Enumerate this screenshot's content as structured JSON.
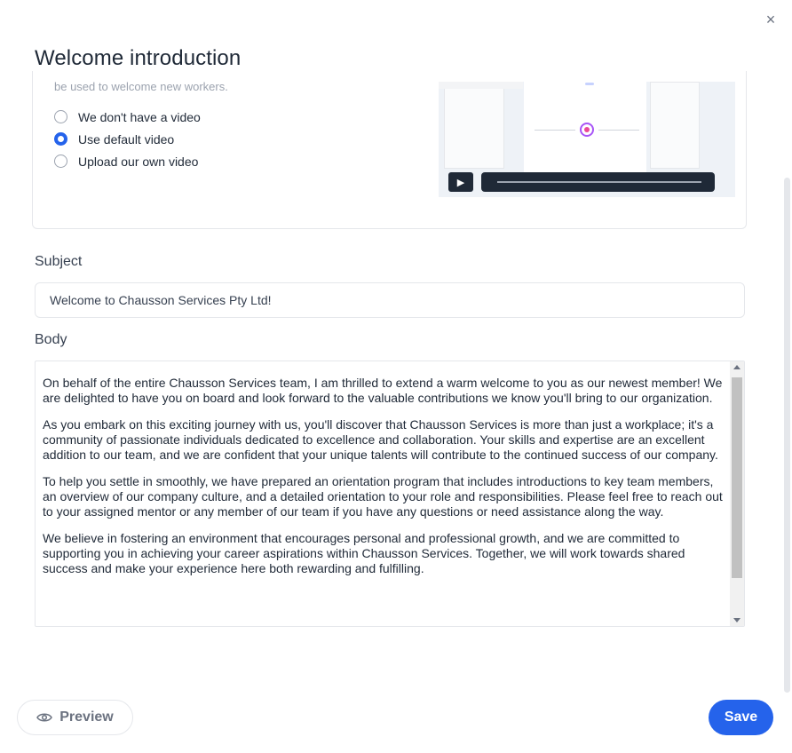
{
  "dialog": {
    "title": "Welcome introduction",
    "close_glyph": "×"
  },
  "video": {
    "description": "be used to welcome new workers.",
    "options": [
      {
        "label": "We don't have a video",
        "selected": false
      },
      {
        "label": "Use default video",
        "selected": true
      },
      {
        "label": "Upload our own video",
        "selected": false
      }
    ],
    "play_glyph": "▶"
  },
  "subject": {
    "label": "Subject",
    "value": "Welcome to Chausson Services Pty Ltd!"
  },
  "body": {
    "label": "Body",
    "paragraphs": [
      "On behalf of the entire Chausson Services team, I am thrilled to extend a warm welcome to you as our newest member! We are delighted to have you on board and look forward to the valuable contributions we know you'll bring to our organization.",
      "As you embark on this exciting journey with us, you'll discover that Chausson Services is more than just a workplace; it's a community of passionate individuals dedicated to excellence and collaboration. Your skills and expertise are an excellent addition to our team, and we are confident that your unique talents will contribute to the continued success of our company.",
      "To help you settle in smoothly, we have prepared an orientation program that includes introductions to key team members, an overview of our company culture, and a detailed orientation to your role and responsibilities. Please feel free to reach out to your assigned mentor or any member of our team if you have any questions or need assistance along the way.",
      "We believe in fostering an environment that encourages personal and professional growth, and we are committed to supporting you in achieving your career aspirations within Chausson Services. Together, we will work towards shared success and make your experience here both rewarding and fulfilling."
    ]
  },
  "footer": {
    "preview_label": "Preview",
    "save_label": "Save"
  },
  "colors": {
    "accent": "#2563eb"
  }
}
